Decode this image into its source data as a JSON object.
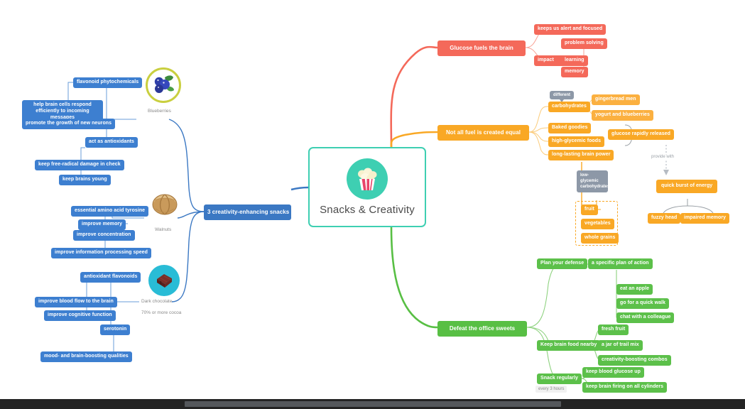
{
  "central": {
    "title": "Snacks & Creativity",
    "icon": "popcorn-icon"
  },
  "branches": {
    "glucose": {
      "root": "Glucose fuels the brain",
      "color": "#f4695a",
      "children": [
        {
          "label": "keeps us alert and focused"
        },
        {
          "label": "impact",
          "children": [
            {
              "label": "problem solving"
            },
            {
              "label": "learning"
            },
            {
              "label": "memory"
            }
          ]
        }
      ]
    },
    "fuel": {
      "root": "Not all fuel is created equal",
      "color": "#f9a825",
      "children": [
        {
          "label": "carbohydrates",
          "callout": "different",
          "children": [
            {
              "label": "gingerbread men"
            },
            {
              "label": "yogurt and blueberries"
            }
          ]
        },
        {
          "label": "Baked goodies"
        },
        {
          "label": "high-glycemic foods"
        },
        {
          "label": "long-lasting brain power"
        }
      ],
      "released": "glucose rapidly released",
      "dotted_label": "provide with",
      "burst": "quick burst of energy",
      "burst_children": [
        "fuzzy head",
        "impaired memory"
      ],
      "grey_note": "low-glycemic carbohydrates",
      "grey_children": [
        "fruit",
        "vegetables",
        "whole grains"
      ]
    },
    "sweets": {
      "root": "Defeat the office sweets",
      "color": "#58bf44",
      "children": [
        {
          "label": "Plan your defense",
          "children": [
            {
              "label": "a specific plan of action",
              "children": [
                {
                  "label": "eat an apple"
                },
                {
                  "label": "go for a quick walk"
                },
                {
                  "label": "chat with a colleague"
                }
              ]
            }
          ]
        },
        {
          "label": "Keep brain food nearby",
          "children": [
            {
              "label": "fresh fruit"
            },
            {
              "label": "a jar of trail mix"
            },
            {
              "label": "creativity-boosting combos"
            }
          ]
        },
        {
          "label": "Snack regularly",
          "note": "every 3 hours",
          "children": [
            {
              "label": "keep blood glucose up"
            },
            {
              "label": "keep brain firing on all cylinders"
            }
          ]
        }
      ]
    },
    "snacks": {
      "root": "3 creativity-enhancing snacks",
      "color": "#3b78c3",
      "items": [
        {
          "name": "Blueberries",
          "icon": "blueberries-icon",
          "children": [
            {
              "label": "flavonoid phytochemicals",
              "children": [
                {
                  "label": "help brain cells respond efficiently to incoming messages"
                },
                {
                  "label": "promote the growth of new neurons"
                }
              ]
            },
            {
              "label": "act as antioxidants",
              "children": [
                {
                  "label": "keep free-radical damage in check"
                },
                {
                  "label": "keep brains young"
                }
              ]
            }
          ]
        },
        {
          "name": "Walnuts",
          "icon": "walnut-icon",
          "children": [
            {
              "label": "essential amino acid tyrosine",
              "children": [
                {
                  "label": "improve memory"
                },
                {
                  "label": "improve concentration"
                },
                {
                  "label": "improve information processing speed"
                }
              ]
            }
          ]
        },
        {
          "name": "Dark chocolate",
          "icon": "chocolate-icon",
          "note": "70% or more cocoa",
          "children": [
            {
              "label": "antioxidant flavonoids",
              "children": [
                {
                  "label": "improve blood flow to the brain"
                },
                {
                  "label": "improve cognitive function"
                }
              ]
            },
            {
              "label": "serotonin",
              "children": [
                {
                  "label": "mood- and brain-boosting qualities"
                }
              ]
            }
          ]
        }
      ]
    }
  }
}
